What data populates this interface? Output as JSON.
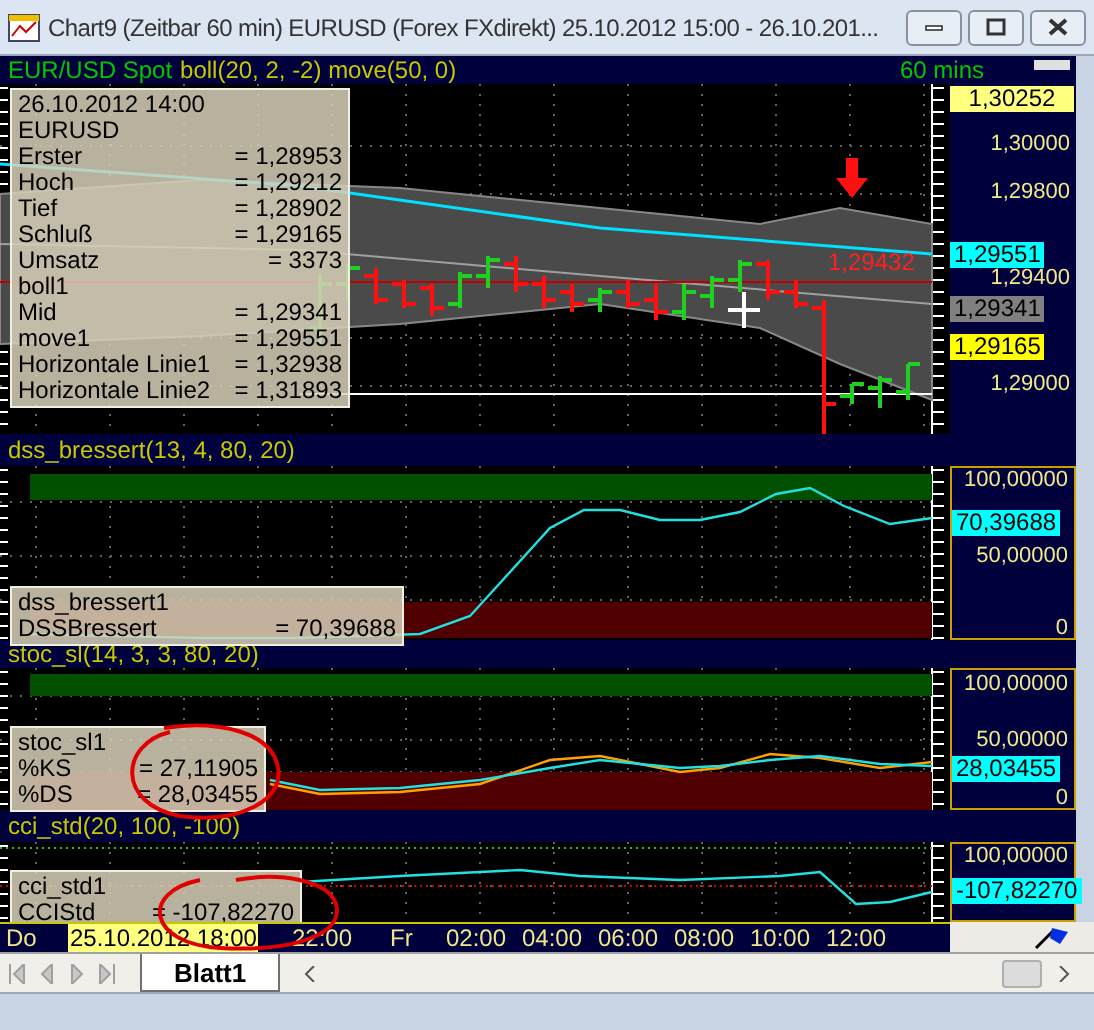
{
  "window": {
    "title": "Chart9 (Zeitbar 60 min)  EURUSD (Forex FXdirekt) 25.10.2012 15:00 - 26.10.201..."
  },
  "panels": [
    {
      "kind": "price",
      "header": [
        {
          "text": "EUR/USD Spot",
          "color": "#00c800"
        },
        {
          "text": "boll(20, 2, -2) move(50, 0)",
          "color": "#c8c800"
        }
      ],
      "interval": "60 mins",
      "price_label": "1,29432",
      "legend": [
        {
          "label": "26.10.2012   14:00"
        },
        {
          "label": "EURUSD"
        },
        {
          "label": "Erster",
          "value": "= 1,28953"
        },
        {
          "label": "Hoch",
          "value": "= 1,29212"
        },
        {
          "label": "Tief",
          "value": "= 1,28902"
        },
        {
          "label": "Schluß",
          "value": "= 1,29165"
        },
        {
          "label": "Umsatz",
          "value": "= 3373"
        },
        {
          "label": "boll1"
        },
        {
          "label": "Mid",
          "value": "= 1,29341"
        },
        {
          "label": "move1",
          "value": "= 1,29551"
        },
        {
          "label": "Horizontale Linie1",
          "value": "= 1,32938"
        },
        {
          "label": "Horizontale Linie2",
          "value": "= 1,31893"
        }
      ],
      "axis_labels": [
        "1,30000",
        "1,29800",
        "1,29400",
        "1,29000"
      ],
      "value_badges": [
        {
          "text": "1,30252",
          "color": "#ffff80"
        },
        {
          "text": "1,29551",
          "color": "#00ffff"
        },
        {
          "text": "1,29341",
          "color": "#808080"
        },
        {
          "text": "1,29165",
          "color": "#ffff00"
        }
      ]
    },
    {
      "kind": "dss",
      "header": [
        {
          "text": "dss_bressert(13, 4, 80, 20)",
          "color": "#c8c800"
        }
      ],
      "legend": [
        {
          "label": "dss_bressert1"
        },
        {
          "label": "DSSBressert",
          "value": "= 70,39688"
        }
      ],
      "axis_labels": [
        "100,00000",
        "50,00000",
        "0"
      ],
      "value_badges": [
        {
          "text": "70,39688",
          "color": "#00ffff"
        }
      ]
    },
    {
      "kind": "stoc",
      "header": [
        {
          "text": "stoc_sl(14, 3, 3, 80, 20)",
          "color": "#c8c800"
        }
      ],
      "legend": [
        {
          "label": "stoc_sl1"
        },
        {
          "label": "%KS",
          "value": "= 27,11905"
        },
        {
          "label": "%DS",
          "value": "= 28,03455"
        }
      ],
      "axis_labels": [
        "100,00000",
        "50,00000",
        "0"
      ],
      "value_badges": [
        {
          "text": "28,03455",
          "color": "#00ffff"
        }
      ]
    },
    {
      "kind": "cci",
      "header": [
        {
          "text": "cci_std(20, 100, -100)",
          "color": "#c8c800"
        }
      ],
      "legend": [
        {
          "label": "cci_std1"
        },
        {
          "label": "CCIStd",
          "value": "= -107,82270"
        }
      ],
      "axis_labels": [
        "100,00000"
      ],
      "value_badges": [
        {
          "text": "-107,82270",
          "color": "#00ffff"
        }
      ]
    }
  ],
  "time_axis": [
    {
      "text": "Do",
      "highlighted": false
    },
    {
      "text": "25.10.2012 18:00",
      "highlighted": true
    },
    {
      "text": "22:00",
      "highlighted": false
    },
    {
      "text": "Fr",
      "highlighted": false
    },
    {
      "text": "02:00",
      "highlighted": false
    },
    {
      "text": "04:00",
      "highlighted": false
    },
    {
      "text": "06:00",
      "highlighted": false
    },
    {
      "text": "08:00",
      "highlighted": false
    },
    {
      "text": "10:00",
      "highlighted": false
    },
    {
      "text": "12:00",
      "highlighted": false
    }
  ],
  "sheet_tabs": [
    {
      "label": "Blatt1",
      "selected": true
    }
  ]
}
